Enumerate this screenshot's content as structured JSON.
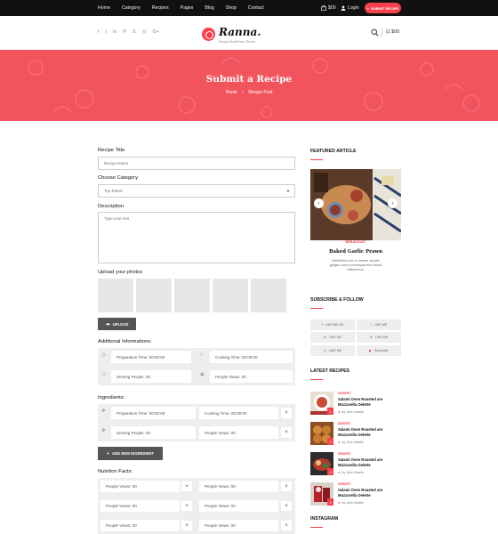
{
  "topbar": {
    "nav": [
      "Home",
      "Category",
      "Recipes",
      "Pages",
      "Blog",
      "Shop",
      "Contact"
    ],
    "cart_amount": "$00",
    "login_label": "Login",
    "submit_label": "SUBMIT RECIPE"
  },
  "header": {
    "social_icons": [
      "facebook-icon",
      "twitter-icon",
      "linkedin-icon",
      "pinterest-icon",
      "skype-icon",
      "rss-icon",
      "google-plus-icon"
    ],
    "logo_name": "Ranna.",
    "logo_tagline": "Recipe WordPress Theme",
    "cart_amount": "$00"
  },
  "hero": {
    "title": "Submit a Recipe",
    "crumb_home": "Home",
    "crumb_current": "Recipe Post"
  },
  "form": {
    "title_label": "Recipe Title",
    "title_placeholder": "Recipe Name",
    "category_label": "Choose Category",
    "category_value": "Top Rated",
    "description_label": "Description",
    "description_placeholder": "Type your text",
    "photos_label": "Upload your photos",
    "upload_label": "UPLOAD",
    "additional_label": "Additional Informations:",
    "prep_time": "Preparation Time: 00:00:00",
    "cook_time": "Cooking Time: 00:00:00",
    "serving": "Serving People: 00",
    "people_views": "People Views: 00",
    "ingredients_label": "Ingredients:",
    "ing_prep": "Preparation Time: 00:00:00",
    "ing_cook": "Cooking Time: 00:00:00",
    "ing_serving": "Serving People: 00",
    "ing_views": "People Views: 00",
    "add_ingredient_label": "ADD NEW INGREDIENT",
    "nutrition_label": "Nutrition Facts:",
    "nutrition_value": "People Views: 00"
  },
  "sidebar": {
    "featured_heading": "FEATURED ARTICLE",
    "featured_category": "BREAKFAST",
    "featured_title": "Baked Garlic Prawn",
    "featured_excerpt": "Definitions not or veneer simple gelgan cumo consequat ase loiunit efficiennus.",
    "subscribe_heading": "SUBSCRIBE & FOLLOW",
    "follow": [
      "LIKE ME ON",
      "LIKE ME",
      "LIKE ME",
      "LIKE ME",
      "LIKE ME",
      "Subscribe"
    ],
    "latest_heading": "LATEST RECIPES",
    "recipes": [
      {
        "cat": "DESERT",
        "title": "Salami Oven Roasted are Mozzarella Oelette",
        "author": "by John Martin",
        "num": "1"
      },
      {
        "cat": "DESERT",
        "title": "Salami Oven Roasted are Mozzarella Oelette",
        "author": "by John Martin",
        "num": "2"
      },
      {
        "cat": "DESERT",
        "title": "Salami Oven Roasted are Mozzarella Oelette",
        "author": "by John Martin",
        "num": "3"
      },
      {
        "cat": "DESERT",
        "title": "Salami Oven Roasted are Mozzarella Oelette",
        "author": "by John Martin",
        "num": "4"
      }
    ],
    "instagram_heading": "INSTAGRAM"
  },
  "colors": {
    "accent": "#f5424d",
    "dark": "#111111"
  }
}
